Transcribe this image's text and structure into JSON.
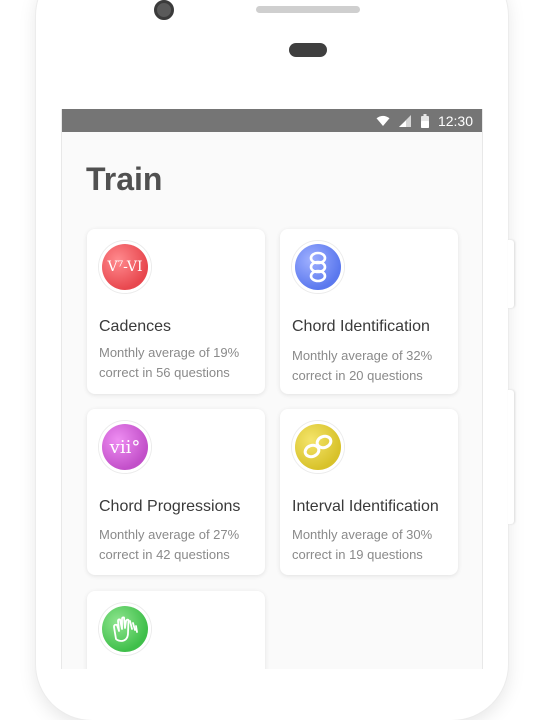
{
  "status_bar": {
    "time": "12:30",
    "icons": [
      "wifi-icon",
      "signal-icon",
      "battery-icon"
    ]
  },
  "page": {
    "title": "Train"
  },
  "cards": [
    {
      "title": "Cadences",
      "description": "Monthly average of 19% correct in 56 questions",
      "badge_text": "V⁷-VI",
      "badge_icon": "cadence-icon",
      "color": "#e8474e"
    },
    {
      "title": "Chord Identification",
      "description": "Monthly average of 32% correct in 20 questions",
      "badge_text": "8",
      "badge_icon": "chord-stack-icon",
      "color": "#5b78ee"
    },
    {
      "title": "Chord Progressions",
      "description": "Monthly average of 27% correct in 42 questions",
      "badge_text": "vii°",
      "badge_icon": "progression-icon",
      "color": "#c24fc9"
    },
    {
      "title": "Interval Identification",
      "description": "Monthly average of 30% correct in 19 questions",
      "badge_text": "",
      "badge_icon": "interval-notes-icon",
      "color": "#d8c22a"
    },
    {
      "title": "",
      "description": "",
      "badge_text": "",
      "badge_icon": "clapping-hands-icon",
      "color": "#3fbf4a"
    }
  ]
}
